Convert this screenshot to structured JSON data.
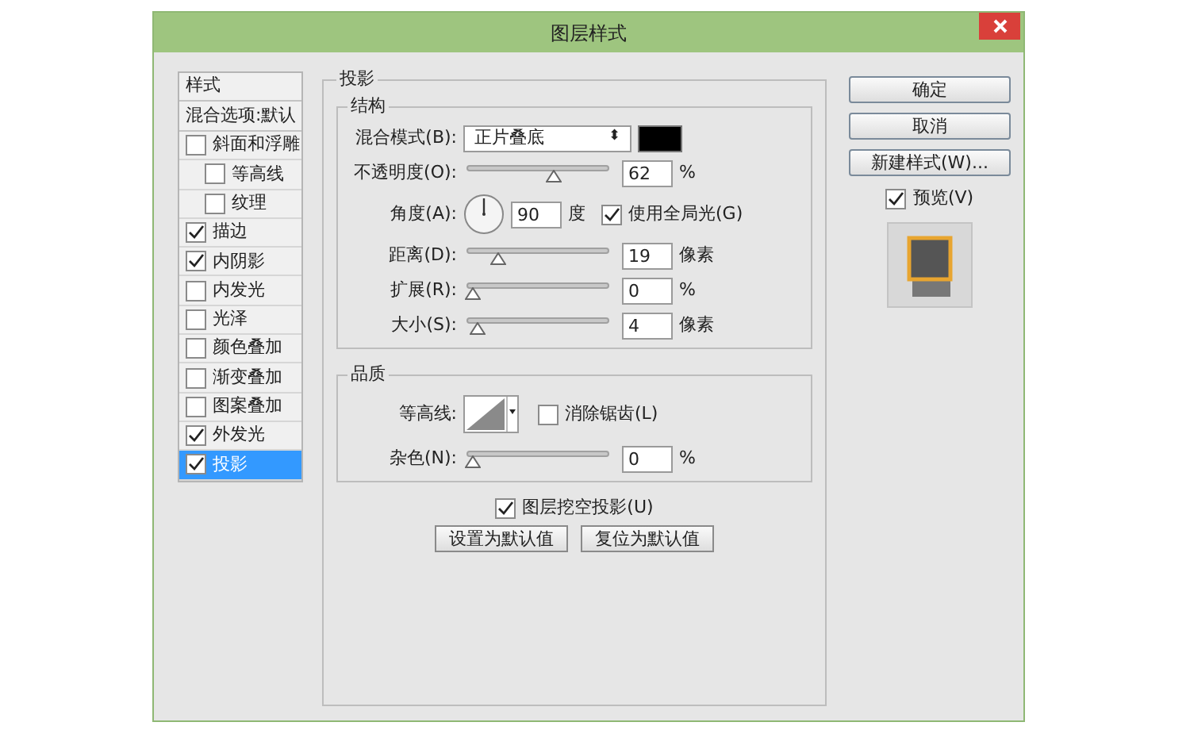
{
  "window": {
    "title": "图层样式"
  },
  "styles_list": {
    "header": "样式",
    "items": [
      {
        "kind": "option",
        "label": "混合选项:默认",
        "selected": false
      },
      {
        "kind": "check",
        "label": "斜面和浮雕",
        "checked": false,
        "selected": false,
        "children": [
          {
            "kind": "check",
            "label": "等高线",
            "checked": false,
            "selected": false
          },
          {
            "kind": "check",
            "label": "纹理",
            "checked": false,
            "selected": false
          }
        ]
      },
      {
        "kind": "check",
        "label": "描边",
        "checked": true,
        "selected": false
      },
      {
        "kind": "check",
        "label": "内阴影",
        "checked": true,
        "selected": false
      },
      {
        "kind": "check",
        "label": "内发光",
        "checked": false,
        "selected": false
      },
      {
        "kind": "check",
        "label": "光泽",
        "checked": false,
        "selected": false
      },
      {
        "kind": "check",
        "label": "颜色叠加",
        "checked": false,
        "selected": false
      },
      {
        "kind": "check",
        "label": "渐变叠加",
        "checked": false,
        "selected": false
      },
      {
        "kind": "check",
        "label": "图案叠加",
        "checked": false,
        "selected": false
      },
      {
        "kind": "check",
        "label": "外发光",
        "checked": true,
        "selected": false
      },
      {
        "kind": "check",
        "label": "投影",
        "checked": true,
        "selected": true
      }
    ]
  },
  "panel": {
    "title": "投影",
    "structure": {
      "title": "结构",
      "blend_mode": {
        "label": "混合模式(B):",
        "value": "正片叠底",
        "arrow": "⬍",
        "color": "#000000"
      },
      "opacity": {
        "label": "不透明度(O):",
        "level": 0.62,
        "value": "62",
        "unit": "%"
      },
      "angle": {
        "label": "角度(A):",
        "value": "90",
        "unit": "度",
        "global_light": {
          "label": "使用全局光(G)",
          "checked": true
        }
      },
      "distance": {
        "label": "距离(D):",
        "level": 0.19,
        "value": "19",
        "unit": "像素"
      },
      "spread": {
        "label": "扩展(R):",
        "level": 0,
        "value": "0",
        "unit": "%"
      },
      "size": {
        "label": "大小(S):",
        "level": 0.04,
        "value": "4",
        "unit": "像素"
      }
    },
    "quality": {
      "title": "品质",
      "contour": {
        "label": "等高线:",
        "anti_alias": {
          "label": "消除锯齿(L)",
          "checked": false
        }
      },
      "noise": {
        "label": "杂色(N):",
        "level": 0,
        "value": "0",
        "unit": "%"
      }
    },
    "knockout": {
      "label": "图层挖空投影(U)",
      "checked": true
    },
    "buttons": [
      "设置为默认值",
      "复位为默认值"
    ]
  },
  "side": {
    "buttons": [
      "确定",
      "取消",
      "新建样式(W)..."
    ],
    "preview": {
      "label": "预览(V)",
      "checked": true
    }
  }
}
